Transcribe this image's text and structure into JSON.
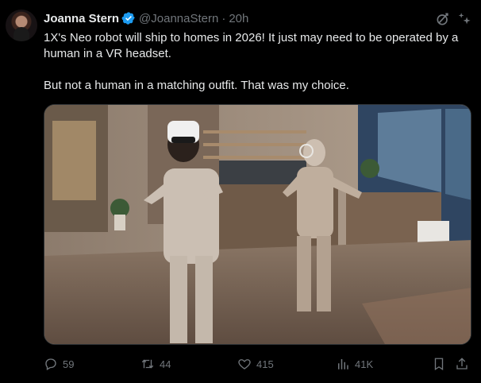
{
  "author": {
    "name": "Joanna Stern",
    "handle": "@JoannaStern",
    "separator": "·",
    "time": "20h",
    "verified": true
  },
  "tweet": {
    "line1": "1X's Neo robot will ship to homes in 2026! It just may need to be operated by a human in a VR headset.",
    "line2": "But not a human in a matching outfit. That was my choice."
  },
  "icons": {
    "verified": "verified-badge-icon",
    "grok": "grok-icon",
    "more": "more-icon",
    "reply": "reply-icon",
    "repost": "repost-icon",
    "like": "like-icon",
    "views": "views-icon",
    "bookmark": "bookmark-icon",
    "share": "share-icon"
  },
  "stats": {
    "replies": "59",
    "reposts": "44",
    "likes": "415",
    "views": "41K"
  },
  "colors": {
    "background": "#000000",
    "text": "#e7e9ea",
    "muted": "#71767b",
    "verified": "#1d9bf0"
  }
}
